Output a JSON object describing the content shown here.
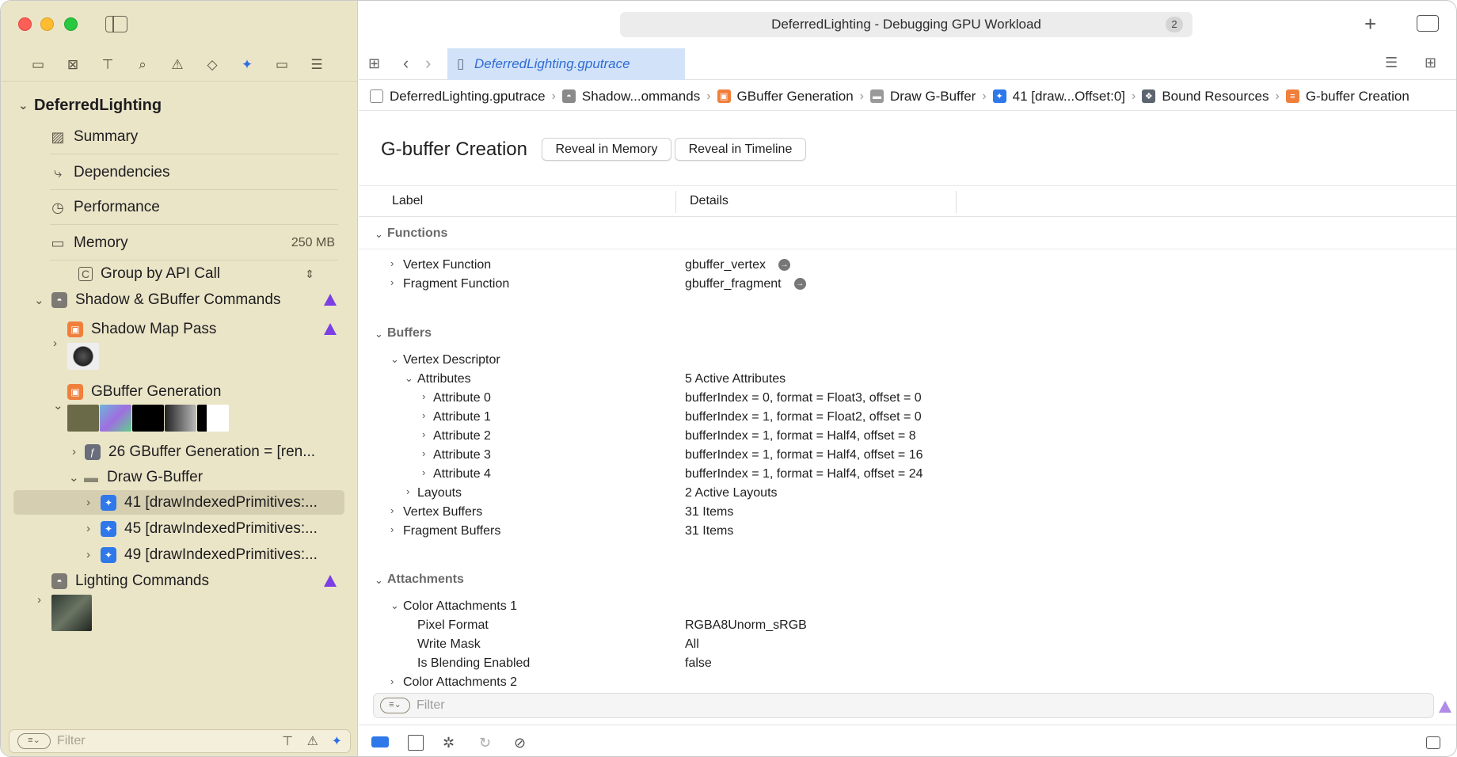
{
  "window": {
    "title": "DeferredLighting - Debugging GPU Workload",
    "badge": "2"
  },
  "sidebar": {
    "root_label": "DeferredLighting",
    "nav_items": [
      {
        "label": "Summary"
      },
      {
        "label": "Dependencies"
      },
      {
        "label": "Performance"
      },
      {
        "label": "Memory",
        "value": "250 MB"
      }
    ],
    "group_by": "Group by API Call",
    "tree": {
      "shadow_gbuffer": "Shadow & GBuffer Commands",
      "shadow_map_pass": "Shadow Map Pass",
      "gbuffer_generation": "GBuffer Generation",
      "gbuffer_call": "26 GBuffer Generation = [ren...",
      "draw_gbuffer": "Draw G-Buffer",
      "draws": [
        "41 [drawIndexedPrimitives:...",
        "45 [drawIndexedPrimitives:...",
        "49 [drawIndexedPrimitives:..."
      ],
      "lighting": "Lighting Commands"
    },
    "filter_placeholder": "Filter"
  },
  "editor": {
    "tab_label": "DeferredLighting.gputrace",
    "breadcrumbs": [
      "DeferredLighting.gputrace",
      "Shadow...ommands",
      "GBuffer Generation",
      "Draw G-Buffer",
      "41 [draw...Offset:0]",
      "Bound Resources",
      "G-buffer Creation"
    ],
    "title": "G-buffer Creation",
    "reveal_memory": "Reveal in Memory",
    "reveal_timeline": "Reveal in Timeline",
    "columns": {
      "label": "Label",
      "details": "Details"
    },
    "functions": {
      "section": "Functions",
      "vertex_label": "Vertex Function",
      "vertex_value": "gbuffer_vertex",
      "fragment_label": "Fragment Function",
      "fragment_value": "gbuffer_fragment"
    },
    "buffers": {
      "section": "Buffers",
      "vertex_descriptor": "Vertex Descriptor",
      "attributes_label": "Attributes",
      "attributes_value": "5 Active Attributes",
      "attributes": [
        {
          "label": "Attribute 0",
          "value": "bufferIndex = 0, format = Float3, offset = 0"
        },
        {
          "label": "Attribute 1",
          "value": "bufferIndex = 1, format = Float2, offset = 0"
        },
        {
          "label": "Attribute 2",
          "value": "bufferIndex = 1, format = Half4, offset = 8"
        },
        {
          "label": "Attribute 3",
          "value": "bufferIndex = 1, format = Half4, offset = 16"
        },
        {
          "label": "Attribute 4",
          "value": "bufferIndex = 1, format = Half4, offset = 24"
        }
      ],
      "layouts_label": "Layouts",
      "layouts_value": "2 Active Layouts",
      "vertex_buffers_label": "Vertex Buffers",
      "vertex_buffers_value": "31 Items",
      "fragment_buffers_label": "Fragment Buffers",
      "fragment_buffers_value": "31 Items"
    },
    "attachments": {
      "section": "Attachments",
      "color1": "Color Attachments 1",
      "pixel_format_label": "Pixel Format",
      "pixel_format_value": "RGBA8Unorm_sRGB",
      "write_mask_label": "Write Mask",
      "write_mask_value": "All",
      "blending_label": "Is Blending Enabled",
      "blending_value": "false",
      "color2": "Color Attachments 2"
    },
    "filter_placeholder": "Filter"
  }
}
